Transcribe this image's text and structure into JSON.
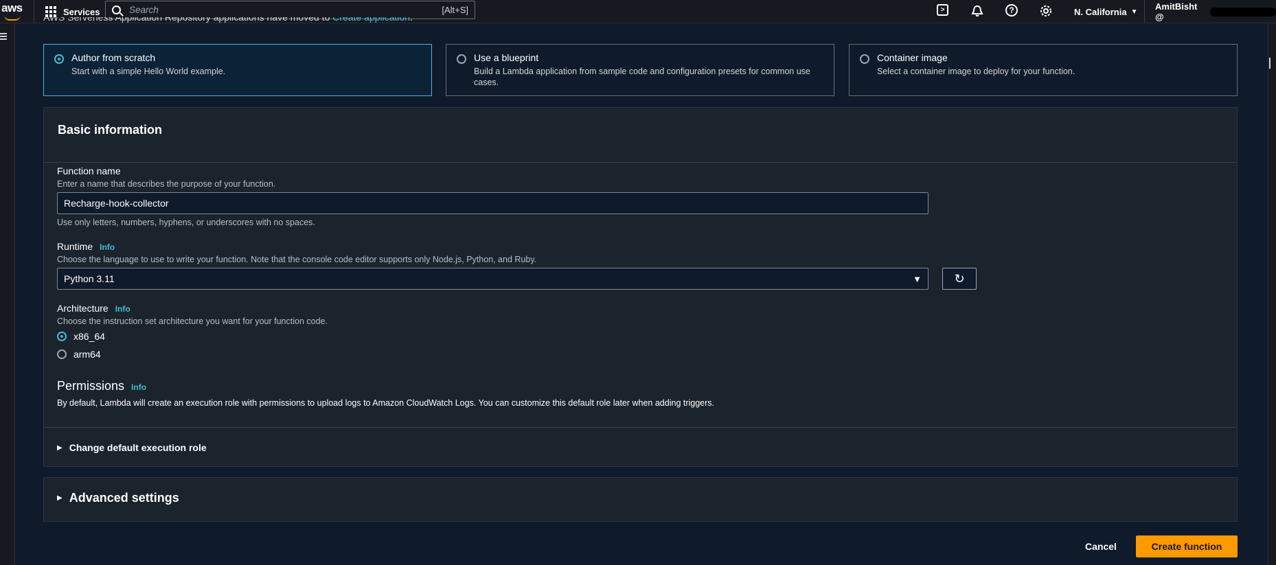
{
  "nav": {
    "logo": "aws",
    "services_label": "Services",
    "search_placeholder": "Search",
    "search_shortcut": "[Alt+S]",
    "region": "N. California",
    "account": "AmitBisht @"
  },
  "banner": {
    "text": "AWS Serverless Application Repository applications have moved to ",
    "link": "Create application",
    "suffix": "."
  },
  "options": [
    {
      "title": "Author from scratch",
      "desc": "Start with a simple Hello World example.",
      "selected": true
    },
    {
      "title": "Use a blueprint",
      "desc": "Build a Lambda application from sample code and configuration presets for common use cases.",
      "selected": false
    },
    {
      "title": "Container image",
      "desc": "Select a container image to deploy for your function.",
      "selected": false
    }
  ],
  "basic_info": {
    "header": "Basic information",
    "function_name": {
      "label": "Function name",
      "desc": "Enter a name that describes the purpose of your function.",
      "value": "Recharge-hook-collector",
      "hint": "Use only letters, numbers, hyphens, or underscores with no spaces."
    },
    "runtime": {
      "label": "Runtime",
      "info": "Info",
      "desc": "Choose the language to use to write your function. Note that the console code editor supports only Node.js, Python, and Ruby.",
      "value": "Python 3.11"
    },
    "architecture": {
      "label": "Architecture",
      "info": "Info",
      "desc": "Choose the instruction set architecture you want for your function code.",
      "options": [
        "x86_64",
        "arm64"
      ],
      "selected": "x86_64"
    },
    "permissions": {
      "label": "Permissions",
      "info": "Info",
      "desc": "By default, Lambda will create an execution role with permissions to upload logs to Amazon CloudWatch Logs. You can customize this default role later when adding triggers."
    },
    "change_role": "Change default execution role"
  },
  "advanced": "Advanced settings",
  "actions": {
    "cancel": "Cancel",
    "create": "Create function"
  },
  "colors": {
    "accent": "#44b9d6",
    "primary_button": "#ff9900"
  }
}
